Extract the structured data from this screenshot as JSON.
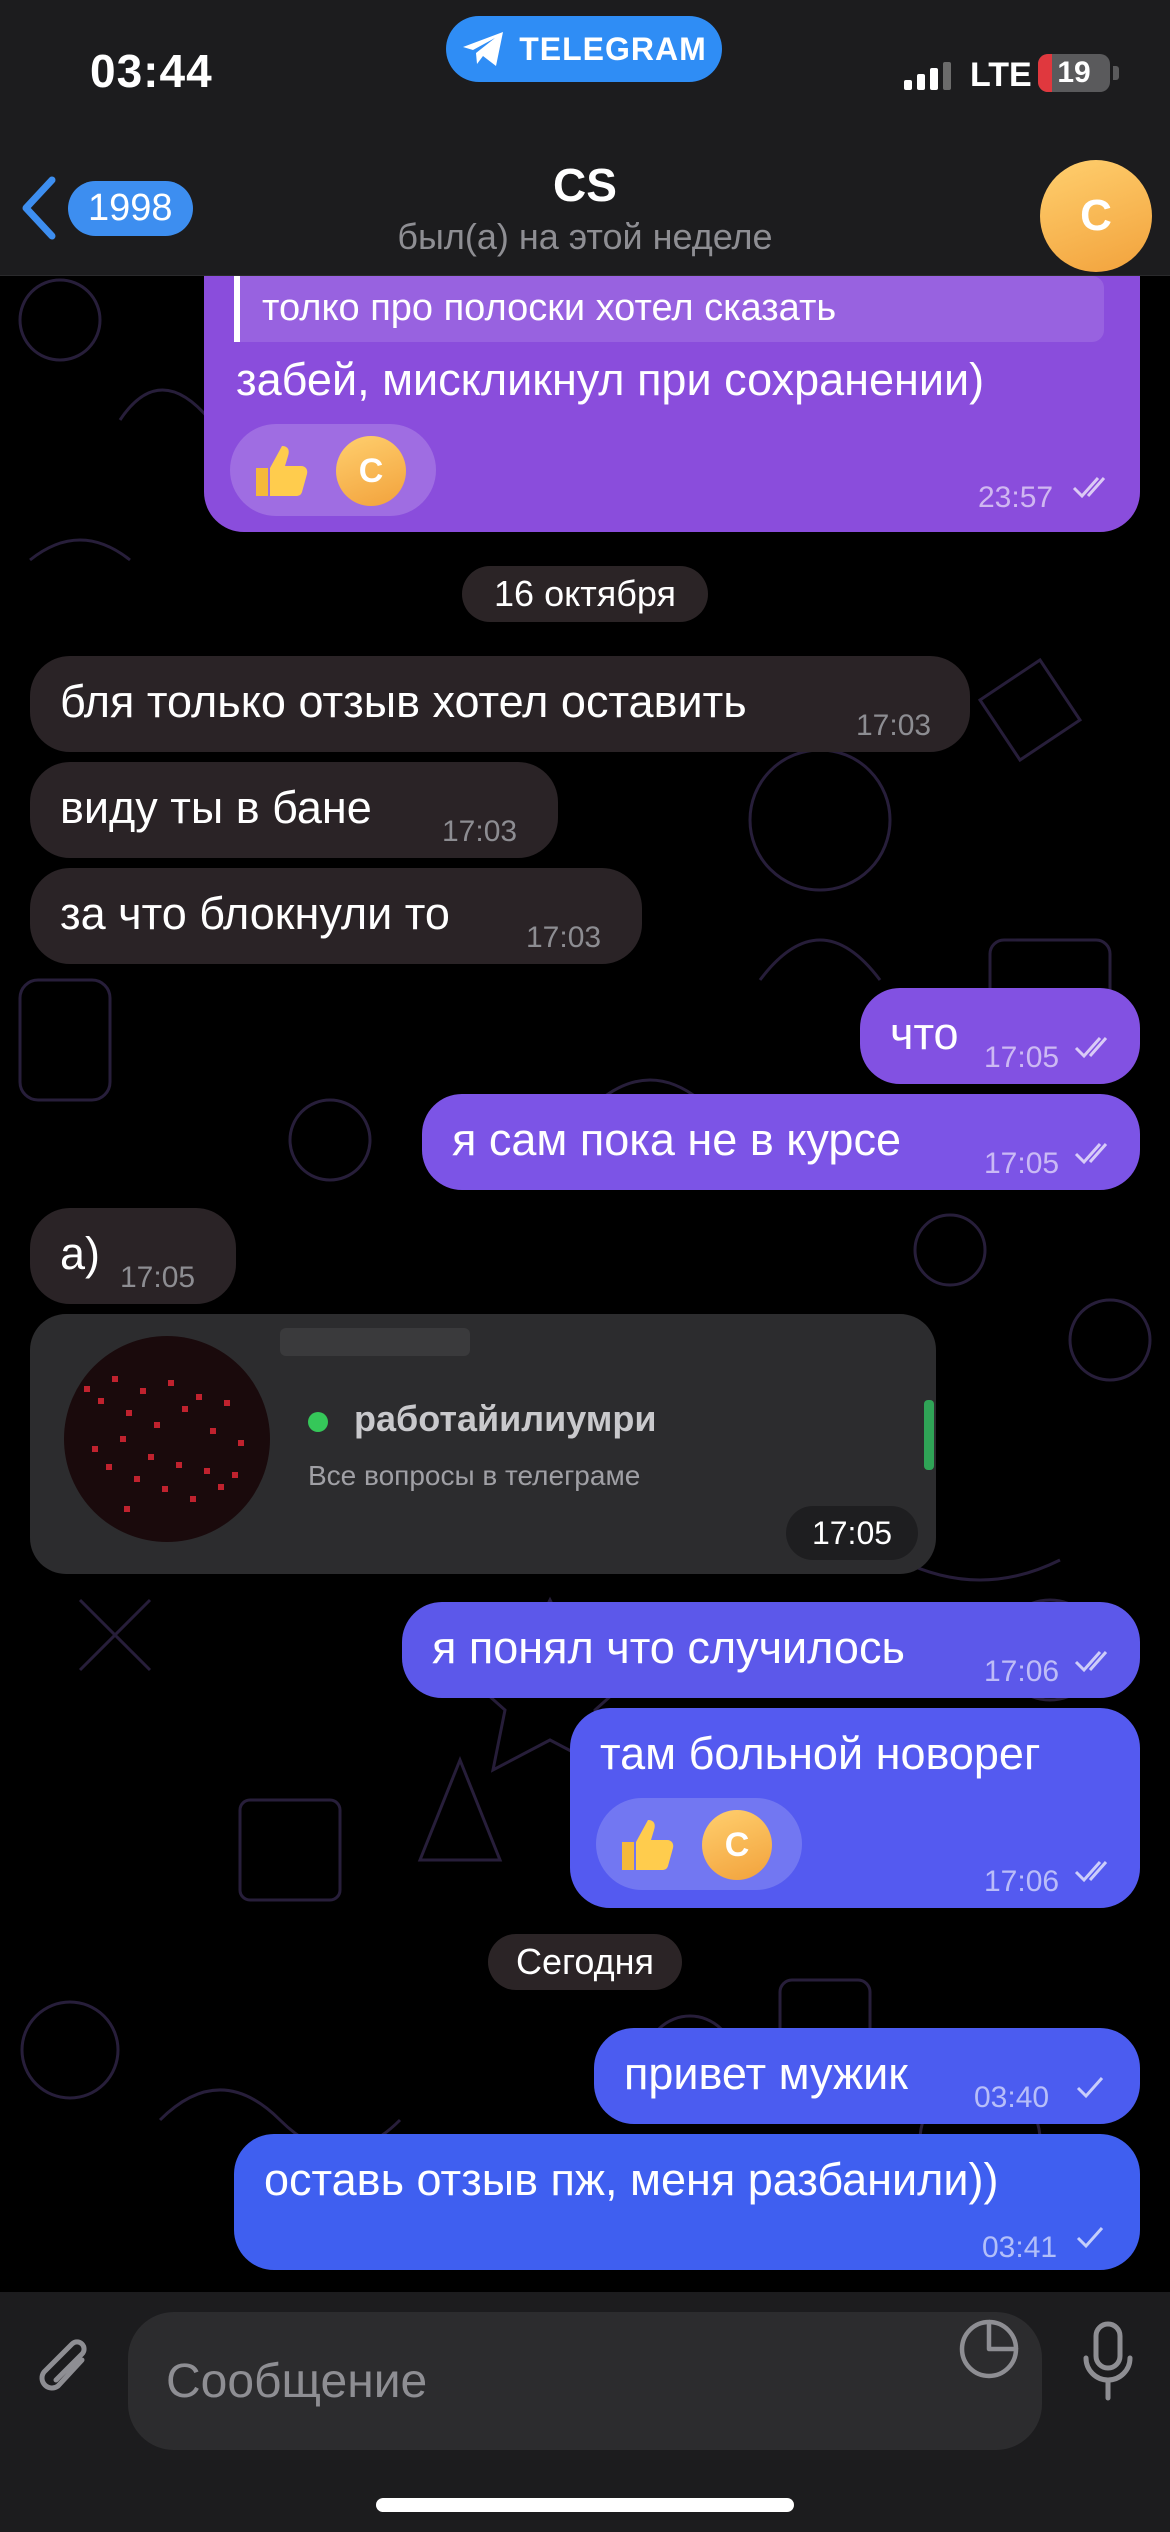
{
  "status_bar": {
    "time": "03:44",
    "app_pill": "TELEGRAM",
    "network": "LTE",
    "battery": "19",
    "battery_fraction": 0.19
  },
  "header": {
    "back_count": "1998",
    "title": "CS",
    "subtitle": "был(а) на этой неделе",
    "avatar_letter": "C"
  },
  "messages": [
    {
      "dir": "out",
      "quote": "толко про полоски хотел сказать",
      "text": "забей, мискликнул при сохранении)",
      "time": "23:57",
      "reaction": {
        "emoji": "thumbs-up",
        "avatar_letter": "C"
      }
    },
    {
      "type": "date",
      "text": "16 октября"
    },
    {
      "dir": "in",
      "text": "бля только отзыв хотел оставить",
      "time": "17:03"
    },
    {
      "dir": "in",
      "text": "виду ты в  бане",
      "time": "17:03"
    },
    {
      "dir": "in",
      "text": "за что блокнули то",
      "time": "17:03"
    },
    {
      "dir": "out",
      "text": "что",
      "time": "17:05"
    },
    {
      "dir": "out",
      "text": "я сам пока не в курсе",
      "time": "17:05"
    },
    {
      "dir": "in",
      "text": "а)",
      "time": "17:05"
    },
    {
      "type": "shared",
      "name": "работайилиумри",
      "description": "Все вопросы в телеграме",
      "time": "17:05"
    },
    {
      "dir": "out",
      "text": "я понял что случилось",
      "time": "17:06"
    },
    {
      "dir": "out",
      "text": "там больной новорег",
      "time": "17:06",
      "reaction": {
        "emoji": "thumbs-up",
        "avatar_letter": "C"
      }
    },
    {
      "type": "date",
      "text": "Сегодня"
    },
    {
      "dir": "out",
      "text": "привет мужик",
      "time": "03:40"
    },
    {
      "dir": "out",
      "text": "оставь отзыв пж, меня разбанили))",
      "time": "03:41"
    }
  ],
  "input": {
    "placeholder": "Сообщение"
  },
  "colors": {
    "accent": "#3d8ef0",
    "incoming": "#2a2326",
    "outgoing_top": "#8e4ee0",
    "outgoing_bottom": "#3f5ff0",
    "avatar": "#f2a23c"
  }
}
